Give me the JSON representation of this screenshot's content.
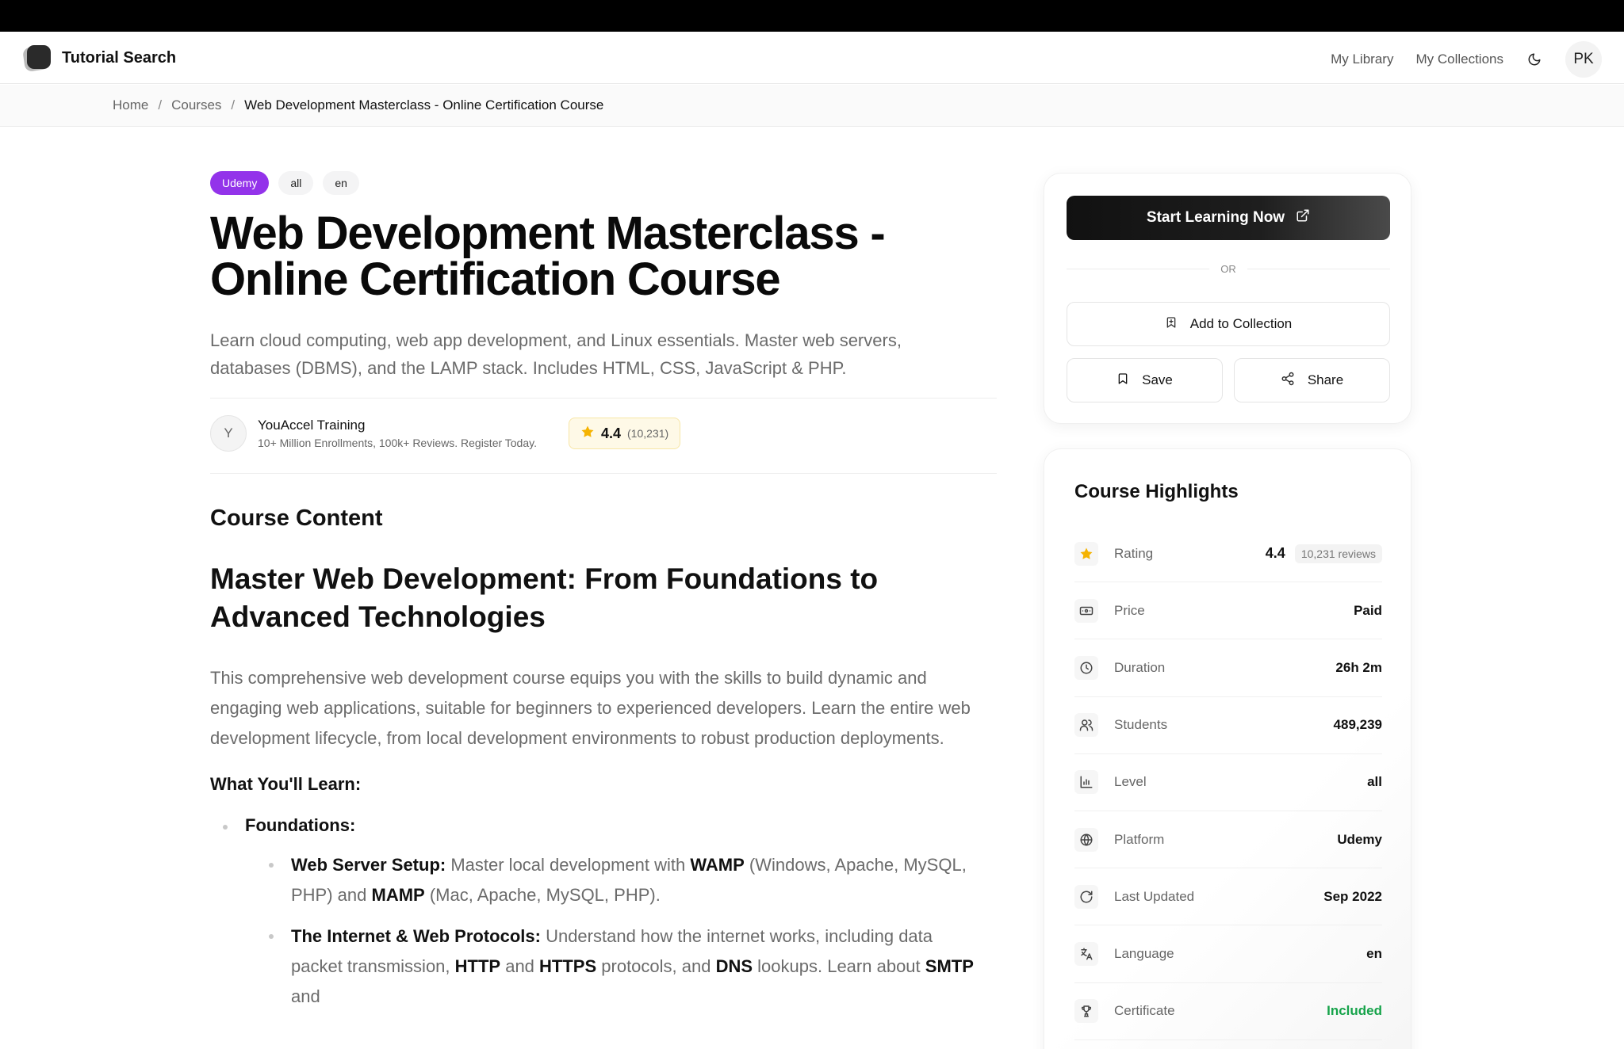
{
  "app": {
    "name": "Tutorial Search"
  },
  "nav": {
    "my_library": "My Library",
    "my_collections": "My Collections",
    "avatar_initials": "PK"
  },
  "breadcrumb": {
    "home": "Home",
    "courses": "Courses",
    "current": "Web Development Masterclass - Online Certification Course"
  },
  "course": {
    "badges": [
      "Udemy",
      "all",
      "en"
    ],
    "title": "Web Development Masterclass - Online Certification Course",
    "subtitle": "Learn cloud computing, web app development, and Linux essentials. Master web servers, databases (DBMS), and the LAMP stack. Includes HTML, CSS, JavaScript & PHP.",
    "instructor": {
      "initial": "Y",
      "name": "YouAccel Training",
      "tagline": "10+ Million Enrollments, 100k+ Reviews. Register Today."
    },
    "rating": {
      "value": "4.4",
      "count": "(10,231)"
    }
  },
  "content": {
    "section_title": "Course Content",
    "heading": "Master Web Development: From Foundations to Advanced Technologies",
    "intro": "This comprehensive web development course equips you with the skills to build dynamic and engaging web applications, suitable for beginners to experienced developers. Learn the entire web development lifecycle, from local development environments to robust production deployments.",
    "learn_heading": "What You'll Learn:",
    "foundations_label": "Foundations:",
    "items": [
      {
        "t1": "Web Server Setup:",
        "t2": " Master local development with ",
        "t3": "WAMP",
        "t4": " (Windows, Apache, MySQL, PHP) and ",
        "t5": "MAMP",
        "t6": " (Mac, Apache, MySQL, PHP)."
      },
      {
        "t1": "The Internet & Web Protocols:",
        "t2": " Understand how the internet works, including data packet transmission, ",
        "t3": "HTTP",
        "t4": " and ",
        "t5": "HTTPS",
        "t6": " protocols, and ",
        "t7": "DNS",
        "t8": " lookups. Learn about ",
        "t9": "SMTP",
        "t10": " and"
      }
    ]
  },
  "actions": {
    "start_learning": "Start Learning Now",
    "or": "OR",
    "add_to_collection": "Add to Collection",
    "save": "Save",
    "share": "Share"
  },
  "highlights": {
    "title": "Course Highlights",
    "rating_label": "Rating",
    "rating_value": "4.4",
    "rating_reviews": "10,231 reviews",
    "rows": [
      {
        "label": "Price",
        "value": "Paid",
        "icon": "banknote-icon"
      },
      {
        "label": "Duration",
        "value": "26h 2m",
        "icon": "clock-icon"
      },
      {
        "label": "Students",
        "value": "489,239",
        "icon": "users-icon"
      },
      {
        "label": "Level",
        "value": "all",
        "icon": "bar-chart-icon"
      },
      {
        "label": "Platform",
        "value": "Udemy",
        "icon": "globe-icon"
      },
      {
        "label": "Last Updated",
        "value": "Sep 2022",
        "icon": "refresh-icon"
      },
      {
        "label": "Language",
        "value": "en",
        "icon": "languages-icon"
      },
      {
        "label": "Certificate",
        "value": "Included",
        "icon": "trophy-icon"
      }
    ]
  },
  "colors": {
    "udemy_badge": "#9333ea",
    "star": "#f5b301",
    "certificate_green": "#16a34a"
  }
}
